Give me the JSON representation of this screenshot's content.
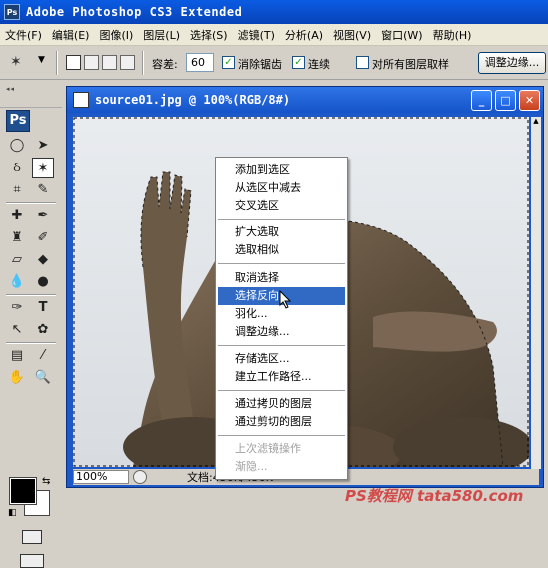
{
  "app": {
    "logo": "Ps",
    "title": "Adobe Photoshop CS3 Extended"
  },
  "menubar": {
    "items": [
      "文件(F)",
      "编辑(E)",
      "图像(I)",
      "图层(L)",
      "选择(S)",
      "滤镜(T)",
      "分析(A)",
      "视图(V)",
      "窗口(W)",
      "帮助(H)"
    ]
  },
  "options": {
    "tolerance_label": "容差:",
    "tolerance_value": "60",
    "antialias_label": "消除锯齿",
    "contiguous_label": "连续",
    "all_layers_label": "对所有图层取样",
    "refine_button": "调整边缘..."
  },
  "toolbox": {
    "logo": "Ps"
  },
  "document": {
    "title": "source01.jpg @ 100%(RGB/8#)",
    "zoom": "100%",
    "doc_info": "文档:456K/456K"
  },
  "context_menu": {
    "group1": [
      "添加到选区",
      "从选区中减去",
      "交叉选区"
    ],
    "group2": [
      "扩大选取",
      "选取相似"
    ],
    "group3": [
      "取消选择",
      "选择反向",
      "羽化...",
      "调整边缘..."
    ],
    "group4": [
      "存储选区...",
      "建立工作路径..."
    ],
    "group5": [
      "通过拷贝的图层",
      "通过剪切的图层"
    ],
    "group6": [
      "上次滤镜操作",
      "渐隐..."
    ],
    "highlighted": "选择反向"
  },
  "watermark": "PS教程网 tata580.com",
  "colors": {
    "accent": "#316ac5",
    "titlebar": "#0a5ce3",
    "statue": "#6b5a45"
  }
}
